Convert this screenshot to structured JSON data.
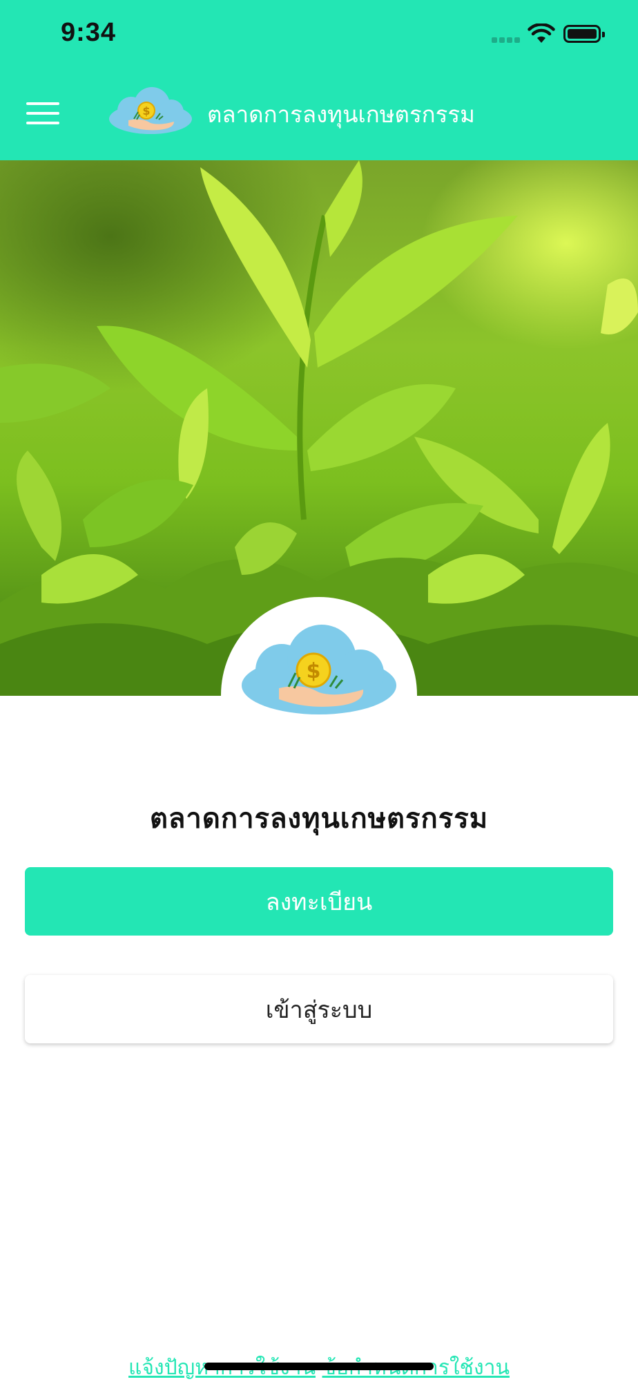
{
  "status_bar": {
    "time": "9:34"
  },
  "header": {
    "title": "ตลาดการลงทุนเกษตรกรรม"
  },
  "main": {
    "title": "ตลาดการลงทุนเกษตรกรรม",
    "register_label": "ลงทะเบียน",
    "login_label": "เข้าสู่ระบบ"
  },
  "footer": {
    "report_link": "แจ้งปัญหาการใช้งาน",
    "terms_link": "ข้อกำหนดการใช้งาน"
  },
  "colors": {
    "accent": "#23E6B4",
    "cloud": "#7FCBEA",
    "coin": "#F5D21E",
    "hand": "#F7C8A0"
  },
  "icons": [
    "hamburger-menu-icon",
    "wifi-icon",
    "battery-icon",
    "app-logo-icon"
  ]
}
